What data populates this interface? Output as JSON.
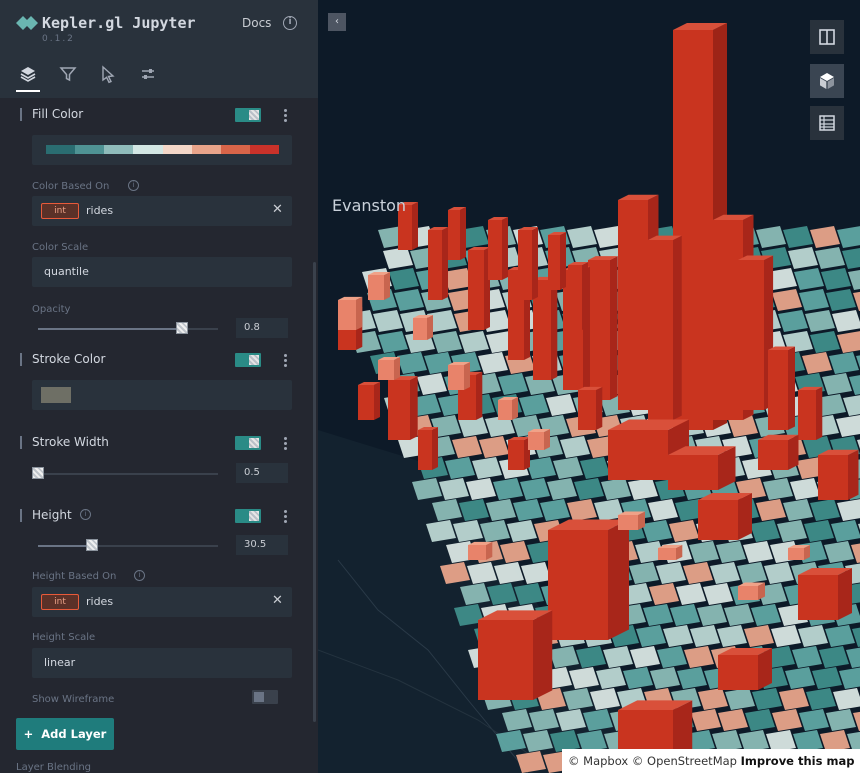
{
  "app": {
    "title": "Kepler.gl Jupyter",
    "version": "0.1.2",
    "docs_label": "Docs",
    "info_glyph": "i"
  },
  "tabs": [
    {
      "name": "layers",
      "icon": "layers-icon",
      "active": true
    },
    {
      "name": "filters",
      "icon": "filter-icon",
      "active": false
    },
    {
      "name": "interactions",
      "icon": "cursor-icon",
      "active": false
    },
    {
      "name": "map-style",
      "icon": "sliders-icon",
      "active": false
    }
  ],
  "fill_color": {
    "title": "Fill Color",
    "palette": [
      "#2a6d71",
      "#4f9394",
      "#8fbcbb",
      "#d3e7e4",
      "#f3d7c8",
      "#e8a48a",
      "#d86549",
      "#c9322a"
    ],
    "color_based_on": {
      "label": "Color Based On",
      "type_badge": "int",
      "field": "rides",
      "clear": "✕"
    },
    "color_scale": {
      "label": "Color Scale",
      "value": "quantile"
    },
    "opacity": {
      "label": "Opacity",
      "value": "0.8",
      "level": 0.8
    }
  },
  "stroke_color": {
    "title": "Stroke Color",
    "swatch": "#6e6f65"
  },
  "stroke_width": {
    "title": "Stroke Width",
    "value": "0.5",
    "level": 0.0
  },
  "height": {
    "title": "Height",
    "value": "30.5",
    "level": 0.3,
    "height_based_on": {
      "label": "Height Based On",
      "type_badge": "int",
      "field": "rides",
      "clear": "✕"
    },
    "height_scale": {
      "label": "Height Scale",
      "value": "linear"
    },
    "show_wireframe": {
      "label": "Show Wireframe",
      "enabled": false
    }
  },
  "add_layer": {
    "label": "Add Layer",
    "icon": "plus-icon",
    "glyph": "+"
  },
  "layer_blending": {
    "label": "Layer Blending"
  },
  "map": {
    "city_label": "Evanston",
    "collapse_glyph": "‹",
    "attribution": {
      "mapbox": "© Mapbox",
      "osm": "© OpenStreetMap",
      "improve": "Improve this map"
    },
    "colors": {
      "high": "#c9341f",
      "mid": "#e8836a",
      "low": "#5fa7a3",
      "lightest": "#d9e6e3"
    }
  }
}
